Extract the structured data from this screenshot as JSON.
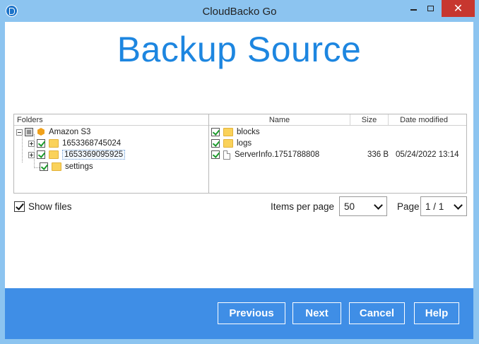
{
  "window": {
    "title": "CloudBacko Go",
    "close_glyph": "✕"
  },
  "heading": "Backup Source",
  "folders": {
    "header": "Folders",
    "root": "Amazon S3",
    "items": [
      "1653368745024",
      "1653369095925",
      "settings"
    ]
  },
  "files": {
    "columns": {
      "name": "Name",
      "size": "Size",
      "date": "Date modified"
    },
    "rows": [
      {
        "name": "blocks",
        "size": "",
        "date": "",
        "type": "folder"
      },
      {
        "name": "logs",
        "size": "",
        "date": "",
        "type": "folder"
      },
      {
        "name": "ServerInfo.1751788808",
        "size": "336 B",
        "date": "05/24/2022 13:14",
        "type": "file"
      }
    ]
  },
  "options": {
    "show_files": "Show files",
    "items_per_page_label": "Items per page",
    "items_per_page_value": "50",
    "page_label": "Page",
    "page_value": "1 / 1"
  },
  "buttons": {
    "previous": "Previous",
    "next": "Next",
    "cancel": "Cancel",
    "help": "Help"
  }
}
